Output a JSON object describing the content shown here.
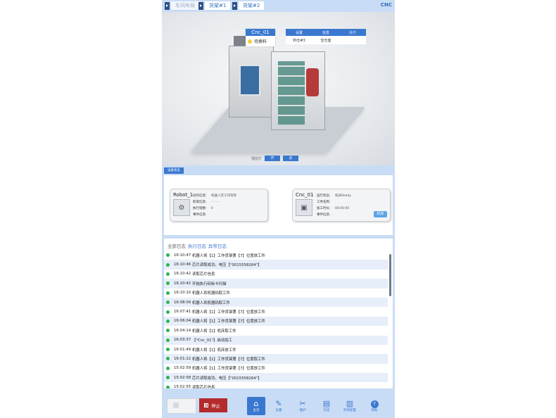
{
  "topbar": {
    "breadcrumbs": [
      "车间布局",
      "货架#1",
      "货架#2"
    ],
    "right_tag": "CNC"
  },
  "scene": {
    "cnc_card": {
      "title": "Cnc_01",
      "status": "待换料"
    },
    "mini_table": {
      "headers": [
        "设置",
        "信息",
        "操作"
      ],
      "row": [
        "料仓#3",
        "空仓室",
        ""
      ]
    },
    "control_label": "播放灯",
    "btn1": "开",
    "btn2": "关"
  },
  "device_section": {
    "label": "设备状态",
    "robot": {
      "name": "Robot_1",
      "fields": [
        {
          "k": "动作信息:",
          "v": "机器人空工作等等"
        },
        {
          "k": "抓取信息:",
          "v": "- - - -"
        },
        {
          "k": "执行指数:",
          "v": "0"
        },
        {
          "k": "事件信息:",
          "v": ""
        }
      ]
    },
    "cnc": {
      "name": "Cnc_01",
      "fields": [
        {
          "k": "运行状态:",
          "v": "机床Ready"
        },
        {
          "k": "工件名称:",
          "v": ""
        },
        {
          "k": "加工时长:",
          "v": "00:00:00"
        },
        {
          "k": "事件信息:",
          "v": ""
        }
      ],
      "button": "机床"
    }
  },
  "logs": {
    "tabs": [
      "全部日志",
      "执行日志",
      "异常日志"
    ],
    "entries": [
      {
        "time": "16:10:47",
        "text": "机器人将【1】工作货架第【7】位置放工件"
      },
      {
        "time": "16:10:46",
        "text": "芯片读取成功。电压【\"0015558264\"】"
      },
      {
        "time": "16:10:42",
        "text": "读取芯片信息"
      },
      {
        "time": "16:10:42",
        "text": "开始执行码标卡扫描"
      },
      {
        "time": "16:10:10",
        "text": "机器人到机器码取工件"
      },
      {
        "time": "16:08:09",
        "text": "机器人到机器码取工件"
      },
      {
        "time": "16:07:41",
        "text": "机器人将【1】工作货架第【7】位置放工件"
      },
      {
        "time": "16:06:04",
        "text": "机器人将【1】工作货架第【7】位置放工件"
      },
      {
        "time": "16:04:14",
        "text": "机器人将【1】机床取工件"
      },
      {
        "time": "16:03:37",
        "text": "【\"Cnc_01\"】启动加工"
      },
      {
        "time": "16:01:49",
        "text": "机器人将【1】机床放工件"
      },
      {
        "time": "16:01:22",
        "text": "机器人将【1】工作货架第【7】位置取工件"
      },
      {
        "time": "15:02:59",
        "text": "机器人将【1】工作货架第【7】位置放工件"
      },
      {
        "time": "15:02:58",
        "text": "芯片读取成功。电压【\"0015558264\"】"
      },
      {
        "time": "15:02:55",
        "text": "读取芯片信息"
      }
    ]
  },
  "bottombar": {
    "start_label": "",
    "stop_label": "停止",
    "nav": [
      {
        "label": "主页",
        "glyph": "⌂",
        "icon": "home-icon"
      },
      {
        "label": "设置",
        "glyph": "✎",
        "icon": "settings-icon"
      },
      {
        "label": "维护",
        "glyph": "✂",
        "icon": "tools-icon"
      },
      {
        "label": "日志",
        "glyph": "▤",
        "icon": "log-icon"
      },
      {
        "label": "料架配置",
        "glyph": "▥",
        "icon": "rack-icon"
      },
      {
        "label": "帮助",
        "glyph": "?",
        "icon": "help-icon"
      }
    ]
  }
}
